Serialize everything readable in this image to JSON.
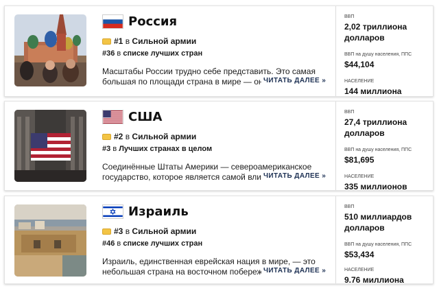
{
  "countries": [
    {
      "name": "Россия",
      "rank_primary_num": "#1",
      "rank_primary_prefix": "в",
      "rank_primary_list": "Сильной армии",
      "rank_secondary_num": "#36",
      "rank_secondary_prefix": "в",
      "rank_secondary_list": "списке лучших стран",
      "description": "Масштабы России трудно себе представить. Это самая большая по площади страна в мире — она г",
      "read_more": "ЧИТАТЬ ДАЛЕЕ »",
      "gdp_label": "ВВП",
      "gdp_value": "2,02 триллиона долларов",
      "gdp_pc_label": "ВВП на душу населения, ППС",
      "gdp_pc_value": "$44,104",
      "pop_label": "НАСЕЛЕНИЕ",
      "pop_value": "144 миллиона"
    },
    {
      "name": "США",
      "rank_primary_num": "#2",
      "rank_primary_prefix": "в",
      "rank_primary_list": "Сильной армии",
      "rank_secondary_num": "#3",
      "rank_secondary_prefix": "в",
      "rank_secondary_list": "Лучших странах в целом",
      "description": "Соединённые Штаты Америки — североамериканское государство, которое является самой влиятельной",
      "read_more": "ЧИТАТЬ ДАЛЕЕ »",
      "gdp_label": "ВВП",
      "gdp_value": "27,4 триллиона долларов",
      "gdp_pc_label": "ВВП на душу населения, ППС",
      "gdp_pc_value": "$81,695",
      "pop_label": "НАСЕЛЕНИЕ",
      "pop_value": "335 миллионов"
    },
    {
      "name": "Израиль",
      "rank_primary_num": "#3",
      "rank_primary_prefix": "в",
      "rank_primary_list": "Сильной армии",
      "rank_secondary_num": "#46",
      "rank_secondary_prefix": "в",
      "rank_secondary_list": "списке лучших стран",
      "description": "Израиль, единственная еврейская нация в мире, — это небольшая страна на восточном побережье",
      "read_more": "ЧИТАТЬ ДАЛЕЕ »",
      "gdp_label": "ВВП",
      "gdp_value": "510 миллиардов долларов",
      "gdp_pc_label": "ВВП на душу населения, ППС",
      "gdp_pc_value": "$53,434",
      "pop_label": "НАСЕЛЕНИЕ",
      "pop_value": "9.76 миллиона"
    }
  ],
  "icons": {
    "badge": "military-badge-icon",
    "flags": [
      "russia-flag-icon",
      "usa-flag-icon",
      "israel-flag-icon"
    ]
  },
  "colors": {
    "read_more": "#1b2f52",
    "badge": "#f3c445",
    "card_border": "#e3e3e3"
  }
}
